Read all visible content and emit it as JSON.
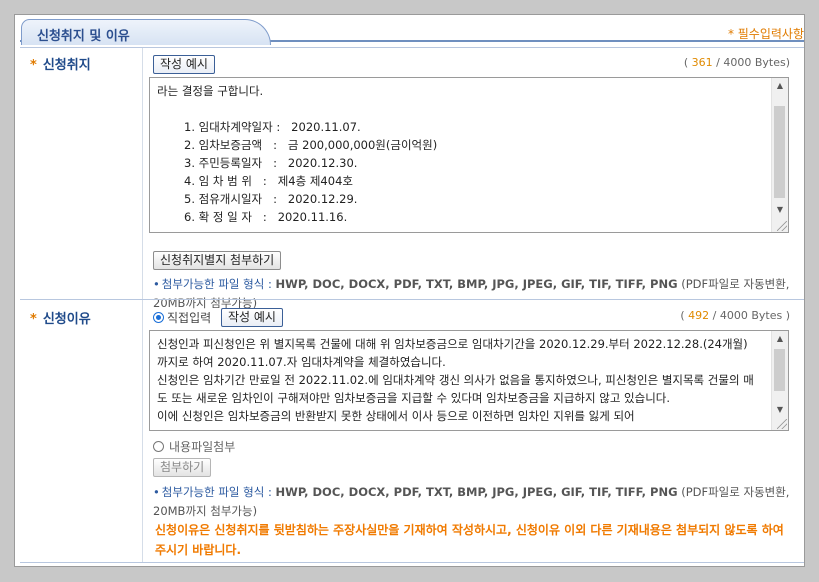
{
  "header": {
    "tab_title": "신청취지 및 이유",
    "required_note": "* 필수입력사항"
  },
  "purpose": {
    "label": "신청취지",
    "example_button": "작성 예시",
    "counter": {
      "open": "( ",
      "count": "361",
      "rest": " / 4000 Bytes)"
    },
    "partial_line": "라는 결정을 구합니다.",
    "lines": [
      "1. 임대차계약일자 :   2020.11.07.",
      "2. 임차보증금액   :   금 200,000,000원(금이억원)",
      "3. 주민등록일자   :   2020.12.30.",
      "4. 임 차 범 위   :   제4층 제404호",
      "5. 점유개시일자   :   2020.12.29.",
      "6. 확 정 일 자   :   2020.11.16."
    ],
    "attach_button": "신청취지별지 첨부하기",
    "info_label": "첨부가능한 파일 형식 : ",
    "info_formats": "HWP, DOC, DOCX, PDF, TXT, BMP, JPG, JPEG, GIF, TIF, TIFF, PNG",
    "info_tail": " (PDF파일로 자동변환, 20MB까지 첨부가능)"
  },
  "reason": {
    "label": "신청이유",
    "direct_input_label": "직접입력",
    "example_button": "작성 예시",
    "counter": {
      "open": "( ",
      "count": "492",
      "rest": " / 4000 Bytes )"
    },
    "text": "신청인과 피신청인은 위 별지목록 건물에 대해 위 임차보증금으로 임대차기간을 2020.12.29.부터 2022.12.28.(24개월)까지로 하여 2020.11.07.자 임대차계약을 체결하였습니다.\n신청인은 임차기간 만료일 전 2022.11.02.에 임대차계약 갱신 의사가 없음을 통지하였으나, 피신청인은 별지목록 건물의 매도 또는 새로운 임차인이 구해져야만 임차보증금을 지급할 수 있다며 임차보증금을 지급하지 않고 있습니다.\n이에 신청인은 임차보증금의 반환받지 못한 상태에서 이사 등으로 이전하면 임차인 지위를 잃게 되어",
    "file_attach_label": "내용파일첨부",
    "attach_button": "첨부하기",
    "info_label": "첨부가능한 파일 형식 : ",
    "info_formats": "HWP, DOC, DOCX, PDF, TXT, BMP, JPG, JPEG, GIF, TIF, TIFF, PNG",
    "info_tail": " (PDF파일로 자동변환, 20MB까지 첨부가능)",
    "warning": "신청이유은 신청취지를 뒷받침하는 주장사실만을 기재하여 작성하시고, 신청이유 이외 다른 기재내용은 첨부되지 않도록 하여 주시기 바랍니다."
  },
  "colors": {
    "accent": "#e07b00",
    "label_blue": "#1f4a8a",
    "warning": "#f07a00"
  }
}
